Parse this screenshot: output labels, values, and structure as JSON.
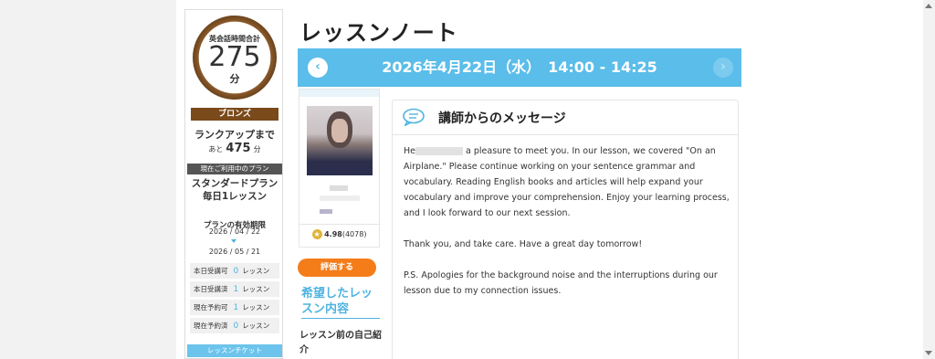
{
  "sidebar": {
    "total_label": "英会話時間合計",
    "total_value": "275",
    "total_unit": "分",
    "rank": "ブロンズ",
    "rankup_label": "ランクアップまで",
    "rankup_prefix": "あと",
    "rankup_value": "475",
    "rankup_unit": "分",
    "plan_header": "現在ご利用中のプラン",
    "plan_name_line1": "スタンダードプラン",
    "plan_name_line2": "毎日1レッスン",
    "period_label": "プランの有効期限",
    "period_start": "2026 / 04 / 22",
    "period_end": "2026 / 05 / 21",
    "stats": [
      {
        "label": "本日受講可",
        "value": "0",
        "unit": "レッスン"
      },
      {
        "label": "本日受講済",
        "value": "1",
        "unit": "レッスン"
      },
      {
        "label": "現在予約可",
        "value": "1",
        "unit": "レッスン"
      },
      {
        "label": "現在予約済",
        "value": "0",
        "unit": "レッスン"
      }
    ],
    "ticket_label": "レッスンチケット"
  },
  "main": {
    "title": "レッスンノート",
    "date_text": "2026年4月22日（水）　14:00 - 14:25",
    "prev_icon": "chevron-left-icon",
    "next_icon": "chevron-right-icon"
  },
  "tutor": {
    "rating": "4.98",
    "rating_count": "(4078)",
    "rate_button": "評価する",
    "wish_title": "希望したレッスン内容",
    "intro_label": "レッスン前の自己紹介"
  },
  "message": {
    "title": "講師からのメッセージ",
    "icon": "speech-bubble-icon",
    "p1_start": "He",
    "p1_rest": " a pleasure to meet you. In our lesson, we covered \"On an Airplane.\" Please continue working on your sentence grammar and vocabulary. Reading English books and articles will help expand your vocabulary and improve your comprehension. Enjoy your learning process, and I look forward to our next session.",
    "p2": "Thank you, and take care. Have a great day tomorrow!",
    "p3": "P.S. Apologies for the background noise and the interruptions during our lesson due to my connection issues."
  },
  "colors": {
    "accent": "#5bbde9",
    "bronze": "#7b4a1a",
    "rate_button": "#f47d1a"
  }
}
